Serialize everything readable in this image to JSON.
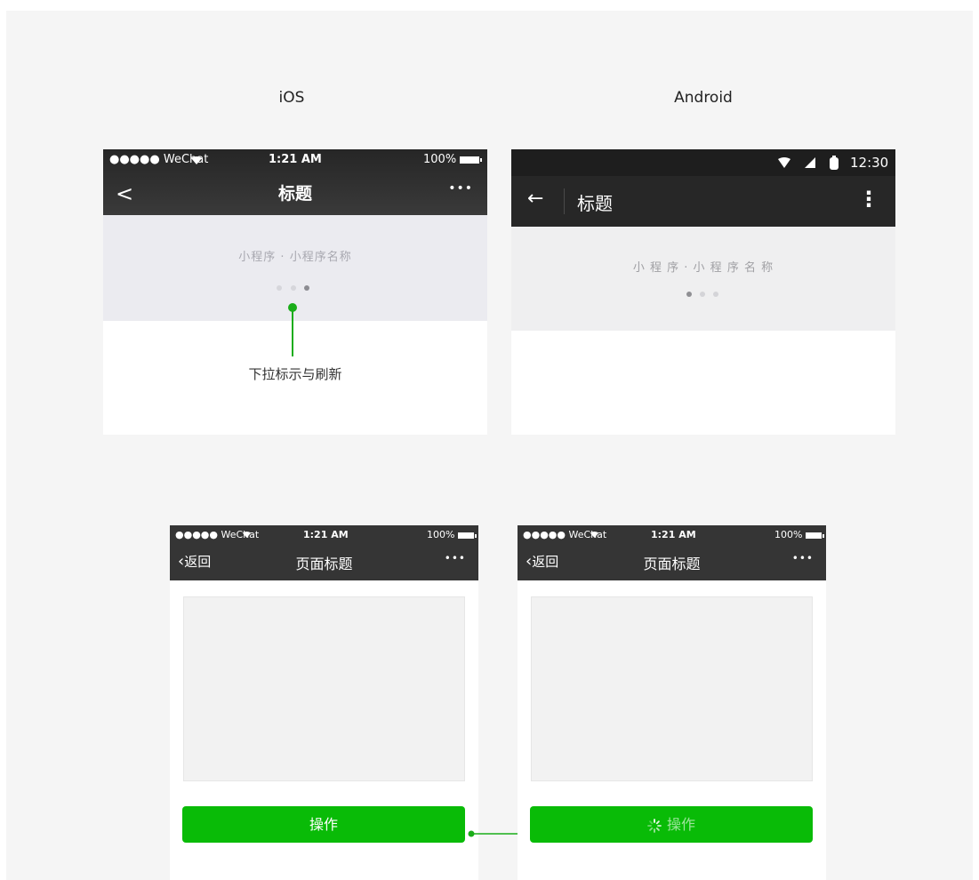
{
  "platforms": {
    "ios": "iOS",
    "android": "Android"
  },
  "ios_top": {
    "status": {
      "carrier": "●●●●● WeChat",
      "wifi": "wifi-icon",
      "time": "1:21 AM",
      "battery": "100%"
    },
    "nav": {
      "back": "<",
      "title": "标题",
      "more": "•••"
    },
    "pull": {
      "text": "小程序 · 小程序名称",
      "dots": [
        "dim",
        "dim",
        "active"
      ]
    },
    "annotation": "下拉标示与刷新"
  },
  "android_top": {
    "status": {
      "time": "12:30",
      "icons": [
        "wifi-icon",
        "signal-icon",
        "battery-icon"
      ]
    },
    "nav": {
      "back": "←",
      "title": "标题",
      "menu": "⋮"
    },
    "pull": {
      "text": "小 程 序 · 小 程 序 名 称",
      "dots": [
        "active",
        "dim",
        "dim"
      ]
    }
  },
  "phones": [
    {
      "status": {
        "carrier": "●●●●● WeChat",
        "time": "1:21 AM",
        "battery": "100%"
      },
      "nav": {
        "back": "返回",
        "title": "页面标题",
        "more": "•••"
      },
      "button": {
        "label": "操作",
        "state": "normal"
      }
    },
    {
      "status": {
        "carrier": "●●●●● WeChat",
        "time": "1:21 AM",
        "battery": "100%"
      },
      "nav": {
        "back": "返回",
        "title": "页面标题",
        "more": "•••"
      },
      "button": {
        "label": "操作",
        "state": "loading"
      }
    }
  ],
  "colors": {
    "accent": "#1aad19",
    "button": "#09bb07",
    "bar_ios": "#2e2e2e",
    "bar_android": "#272727"
  }
}
